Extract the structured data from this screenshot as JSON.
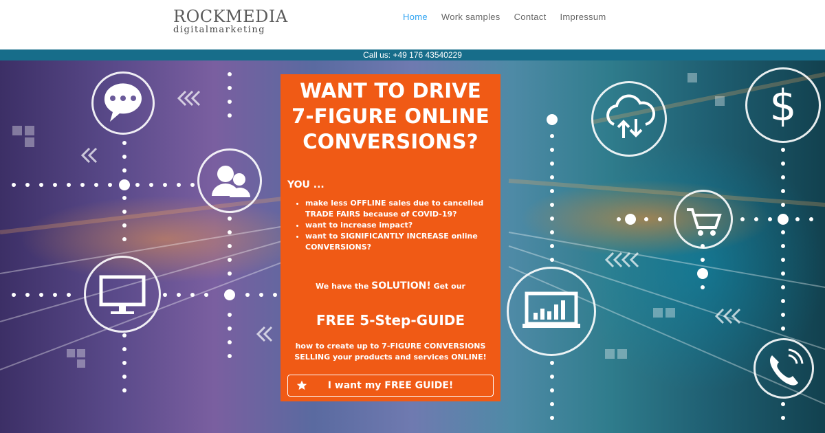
{
  "header": {
    "logo": {
      "brand_primary": "ROCKMEDIA",
      "brand_secondary": "digitalmarketing"
    },
    "nav": [
      {
        "label": "Home",
        "active": true
      },
      {
        "label": "Work samples",
        "active": false
      },
      {
        "label": "Contact",
        "active": false
      },
      {
        "label": "Impressum",
        "active": false
      }
    ],
    "callbar": "Call us: +49 176 43540229"
  },
  "hero": {
    "headline_lines": [
      "WANT TO DRIVE",
      "7-FIGURE ONLINE",
      "CONVERSIONS?"
    ],
    "you_label": "YOU ...",
    "bullets": [
      "make less OFFLINE sales due to cancelled TRADE FAIRS because of COVID-19?",
      "want to increase impact?",
      "want to SIGNIFICANTLY INCREASE online CONVERSIONS?"
    ],
    "solution": {
      "prefix": "We have the",
      "emphasis": "SOLUTION!",
      "suffix": "Get our"
    },
    "guide_title": "FREE 5-Step-GUIDE",
    "howto_lines": [
      "how to create up to 7-FIGURE CONVERSIONS",
      "SELLING your products and services ONLINE!"
    ],
    "cta_label": "I want my FREE GUIDE!"
  },
  "icons": [
    "chat-icon",
    "users-icon",
    "monitor-icon",
    "cloud-sync-icon",
    "dollar-icon",
    "cart-icon",
    "chart-icon",
    "phone-icon",
    "star-icon"
  ],
  "colors": {
    "accent": "#f05a15",
    "nav_active": "#2ea3f2",
    "callbar": "#176d8a"
  }
}
